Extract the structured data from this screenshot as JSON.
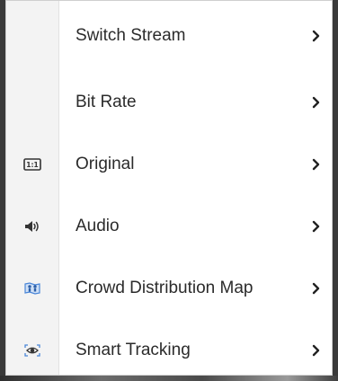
{
  "menu": {
    "items": [
      {
        "label": "Switch Stream",
        "icon": "none",
        "chevron": "chevron-right-icon"
      },
      {
        "label": "Bit Rate",
        "icon": "none",
        "chevron": "chevron-right-icon"
      },
      {
        "label": "Original",
        "icon": "one-to-one-ratio-icon",
        "icon_text": "1:1",
        "chevron": "chevron-right-icon"
      },
      {
        "label": "Audio",
        "icon": "speaker-icon",
        "chevron": "chevron-right-icon"
      },
      {
        "label": "Crowd Distribution Map",
        "icon": "crowd-map-icon",
        "chevron": "chevron-right-icon"
      },
      {
        "label": "Smart Tracking",
        "icon": "eye-tracking-icon",
        "chevron": "chevron-right-icon"
      }
    ]
  },
  "colors": {
    "menu_background": "#ffffff",
    "icon_column_background": "#f3f3f3",
    "text": "#2b2b2b",
    "icon_dark": "#333333",
    "icon_blue": "#4a86d8"
  }
}
